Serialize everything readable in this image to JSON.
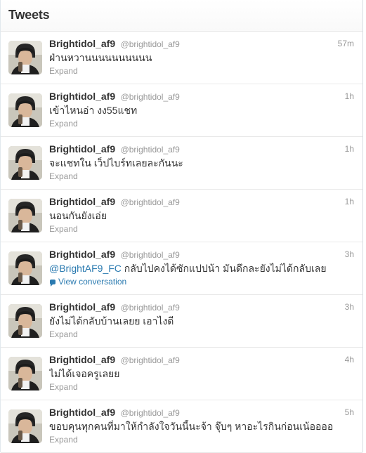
{
  "header": {
    "title": "Tweets"
  },
  "tweets": [
    {
      "name": "Brightidol_af9",
      "handle": "@brightidol_af9",
      "time": "57m",
      "text": "ฝ่านหวานนนนนนนนนน",
      "action": "Expand"
    },
    {
      "name": "Brightidol_af9",
      "handle": "@brightidol_af9",
      "time": "1h",
      "text": "เข้าไหนอ่า งง55แชท",
      "action": "Expand"
    },
    {
      "name": "Brightidol_af9",
      "handle": "@brightidol_af9",
      "time": "1h",
      "text": "จะแชทใน เว็ปไบร์ทเลยละกันนะ",
      "action": "Expand"
    },
    {
      "name": "Brightidol_af9",
      "handle": "@brightidol_af9",
      "time": "1h",
      "text": "นอนกันยังเอ่ย",
      "action": "Expand"
    },
    {
      "name": "Brightidol_af9",
      "handle": "@brightidol_af9",
      "time": "3h",
      "mention": "@BrightAF9_FC",
      "text": " กลับไปคงได้ซักแปปน้า มันดึกละยังไม่ได้กลับเลย",
      "action": "View conversation"
    },
    {
      "name": "Brightidol_af9",
      "handle": "@brightidol_af9",
      "time": "3h",
      "text": "ยังไม่ได้กลับบ้านเลยย เอาไงดี",
      "action": "Expand"
    },
    {
      "name": "Brightidol_af9",
      "handle": "@brightidol_af9",
      "time": "4h",
      "text": "ไม่ได้เจอครูเลยย",
      "action": "Expand"
    },
    {
      "name": "Brightidol_af9",
      "handle": "@brightidol_af9",
      "time": "5h",
      "text": "ขอบคุนทุกคนที่มาให้กำลังใจวันนี้นะจ้า จุ๊บๆ หาอะไรกินก่อนเน้ออออ",
      "action": "Expand"
    }
  ]
}
